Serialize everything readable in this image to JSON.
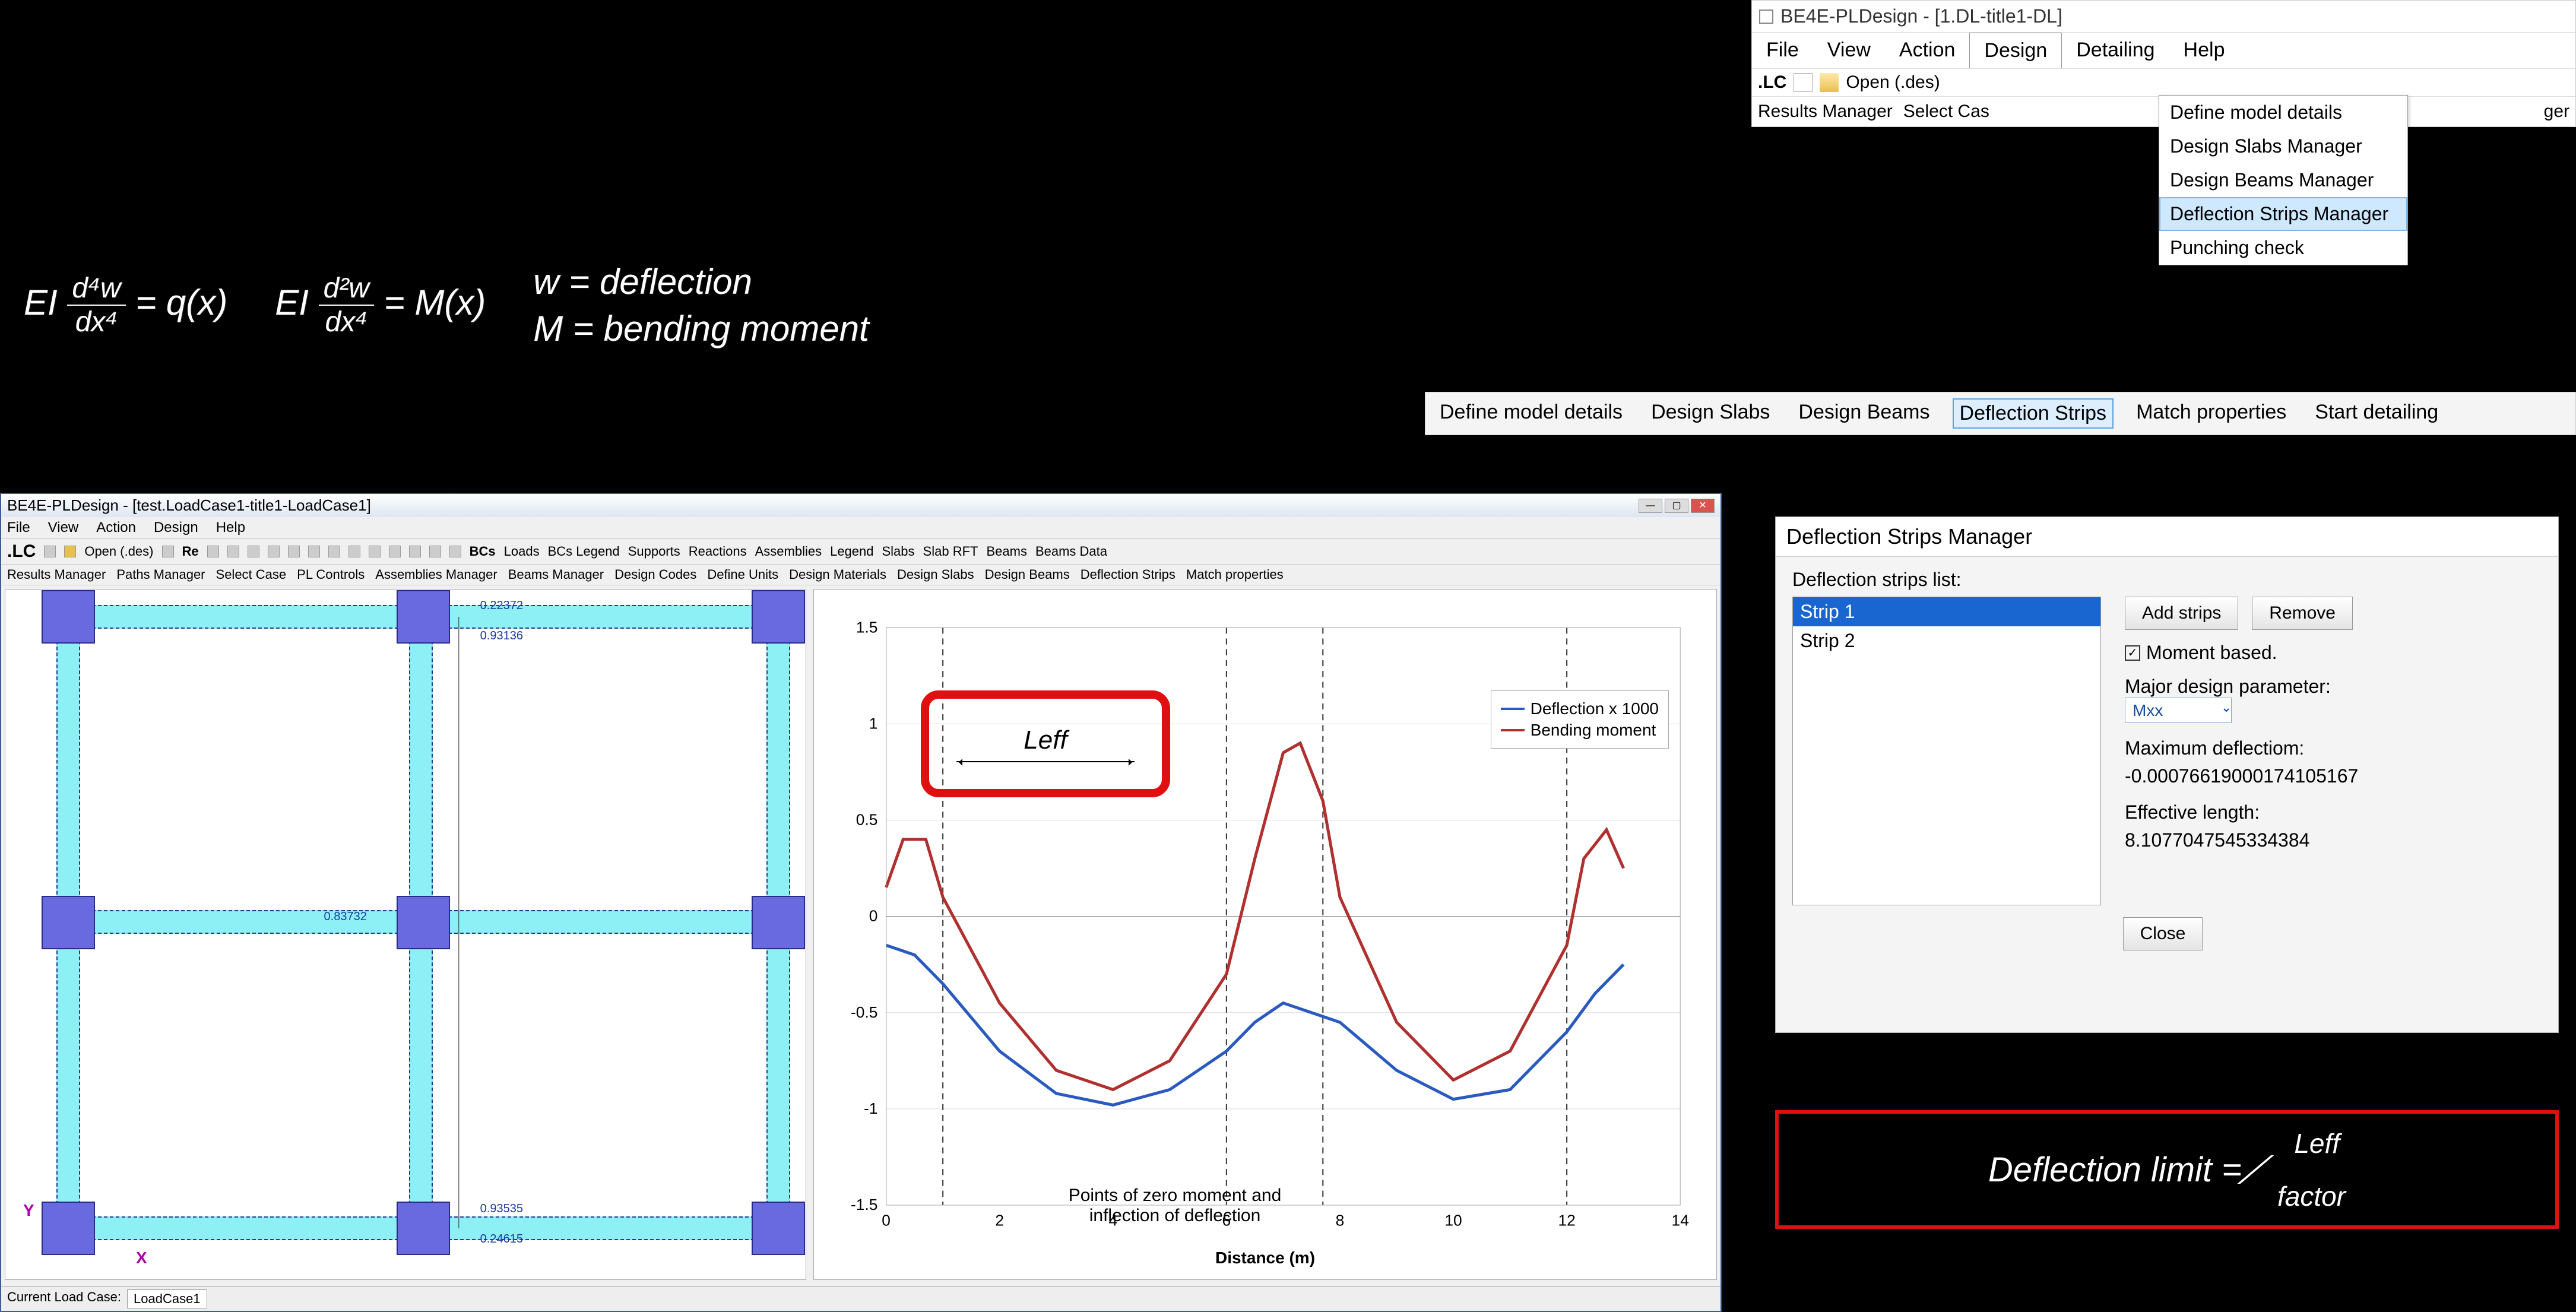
{
  "top_menu": {
    "title": "BE4E-PLDesign - [1.DL-title1-DL]",
    "menus": [
      "File",
      "View",
      "Action",
      "Design",
      "Detailing",
      "Help"
    ],
    "open_menu_index": 3,
    "lc_label": ".LC",
    "open_btn": "Open (.des)",
    "row2_items": [
      "Results Manager",
      "Select Cas"
    ],
    "row2_truncated": "ger",
    "dropdown": {
      "items": [
        "Define model details",
        "Design Slabs Manager",
        "Design Beams Manager",
        "Deflection Strips Manager",
        "Punching check"
      ],
      "hover_index": 3
    }
  },
  "tab_strip": {
    "items": [
      "Define model details",
      "Design Slabs",
      "Design Beams",
      "Deflection Strips",
      "Match properties",
      "Start detailing"
    ],
    "active_index": 3
  },
  "equations": {
    "eq1_lhs": "EI",
    "eq1_num": "d⁴w",
    "eq1_den": "dx⁴",
    "eq1_rhs": "= q(x)",
    "eq2_lhs": "EI",
    "eq2_num": "d²w",
    "eq2_den": "dx⁴",
    "eq2_rhs": "= M(x)",
    "def1": "w = deflection",
    "def2": "M = bending moment"
  },
  "app_window": {
    "title": "BE4E-PLDesign - [test.LoadCase1-title1-LoadCase1]",
    "menus": [
      "File",
      "View",
      "Action",
      "Design",
      "Help"
    ],
    "toolbar1_prefix": ".LC",
    "toolbar1_open": "Open (.des)",
    "toolbar1_re": "Re",
    "toolbar1_bcs": "BCs",
    "toolbar1_items": [
      "Loads",
      "BCs Legend",
      "Supports",
      "Reactions",
      "Assemblies",
      "Legend",
      "Slabs",
      "Slab RFT",
      "Beams",
      "Beams Data"
    ],
    "toolbar2_items": [
      "Results Manager",
      "Paths Manager",
      "Select Case",
      "PL Controls",
      "Assemblies Manager",
      "Beams Manager",
      "Design Codes",
      "Define Units",
      "Design Materials",
      "Design Slabs",
      "Design Beams",
      "Deflection Strips",
      "Match properties"
    ],
    "y_axis": "Y",
    "x_axis": "X",
    "node_values": [
      "0.22372",
      "0.93136",
      "0.83732",
      "0.93535",
      "0.24615"
    ],
    "status_label": "Current Load Case:",
    "status_value": "LoadCase1"
  },
  "chart_data": {
    "type": "line",
    "xlabel": "Distance (m)",
    "ylim": [
      -1.5,
      1.5
    ],
    "xlim": [
      0,
      14
    ],
    "x_ticks": [
      0,
      2,
      4,
      6,
      8,
      10,
      12,
      14
    ],
    "y_ticks": [
      -1.5,
      -1,
      -0.5,
      0,
      0.5,
      1,
      1.5
    ],
    "series": [
      {
        "name": "Deflection x 1000",
        "color": "#2a5ac0",
        "x": [
          0,
          0.5,
          1,
          2,
          3,
          4,
          5,
          6,
          6.5,
          7,
          8,
          9,
          10,
          11,
          12,
          12.5,
          13
        ],
        "y": [
          -0.15,
          -0.2,
          -0.35,
          -0.7,
          -0.92,
          -0.98,
          -0.9,
          -0.7,
          -0.55,
          -0.45,
          -0.55,
          -0.8,
          -0.95,
          -0.9,
          -0.6,
          -0.4,
          -0.25
        ]
      },
      {
        "name": "Bending moment",
        "color": "#b03030",
        "x": [
          0,
          0.3,
          0.7,
          1,
          2,
          3,
          4,
          5,
          6,
          6.5,
          7,
          7.3,
          7.7,
          8,
          9,
          10,
          11,
          12,
          12.3,
          12.7,
          13
        ],
        "y": [
          0.15,
          0.4,
          0.4,
          0.1,
          -0.45,
          -0.8,
          -0.9,
          -0.75,
          -0.3,
          0.3,
          0.85,
          0.9,
          0.6,
          0.1,
          -0.55,
          -0.85,
          -0.7,
          -0.15,
          0.3,
          0.45,
          0.25
        ]
      }
    ],
    "vlines_x": [
      1,
      6,
      7.7,
      12
    ],
    "leff_label": "Leff",
    "annotation": "Points of zero moment and\ninflection of deflection"
  },
  "dialog": {
    "title": "Deflection Strips Manager",
    "list_label": "Deflection strips list:",
    "strips": [
      "Strip 1",
      "Strip 2"
    ],
    "selected_index": 0,
    "add_btn": "Add strips",
    "remove_btn": "Remove",
    "moment_based_label": "Moment based.",
    "moment_based_checked": true,
    "major_param_label": "Major design parameter:",
    "major_param_value": "Mxx",
    "max_defl_label": "Maximum deflectiom:",
    "max_defl_value": "-0.00076619000174105167",
    "eff_len_label": "Effective length:",
    "eff_len_value": "8.1077047545334384",
    "close_btn": "Close"
  },
  "defl_limit": {
    "label": "Deflection limit =",
    "numerator": "Leff",
    "denominator": "factor"
  }
}
